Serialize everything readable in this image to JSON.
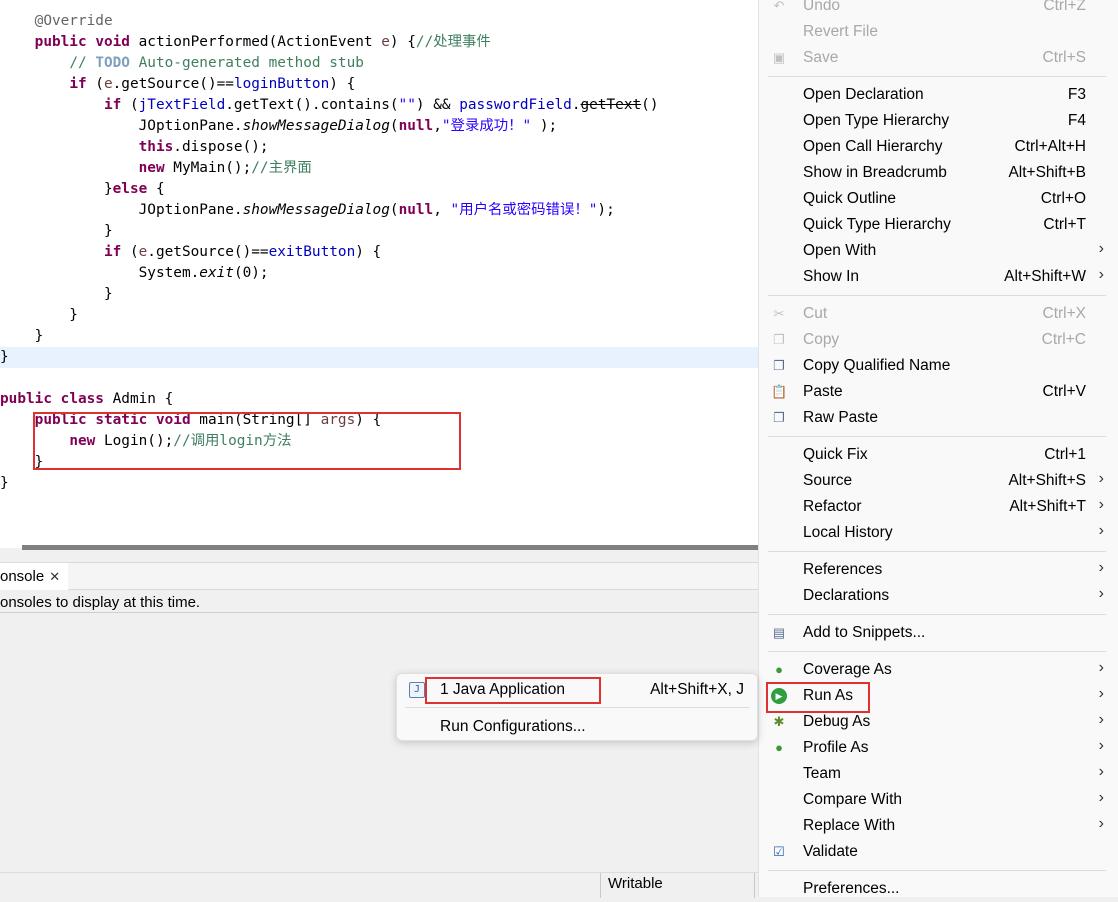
{
  "editor": {
    "lines": [
      [
        {
          "t": "    ",
          "c": ""
        },
        {
          "t": "@Override",
          "c": "ann"
        }
      ],
      [
        {
          "t": "    ",
          "c": ""
        },
        {
          "t": "public",
          "c": "kw"
        },
        {
          "t": " ",
          "c": ""
        },
        {
          "t": "void",
          "c": "kw"
        },
        {
          "t": " actionPerformed(ActionEvent ",
          "c": ""
        },
        {
          "t": "e",
          "c": "prm"
        },
        {
          "t": ") {",
          "c": ""
        },
        {
          "t": "//处理事件",
          "c": "cmt"
        }
      ],
      [
        {
          "t": "        ",
          "c": ""
        },
        {
          "t": "// ",
          "c": "cmt"
        },
        {
          "t": "TODO",
          "c": "todo"
        },
        {
          "t": " Auto-generated method stub",
          "c": "cmt"
        }
      ],
      [
        {
          "t": "        ",
          "c": ""
        },
        {
          "t": "if",
          "c": "kw"
        },
        {
          "t": " (",
          "c": ""
        },
        {
          "t": "e",
          "c": "prm"
        },
        {
          "t": ".getSource()==",
          "c": ""
        },
        {
          "t": "loginButton",
          "c": "fld"
        },
        {
          "t": ") {",
          "c": ""
        }
      ],
      [
        {
          "t": "            ",
          "c": ""
        },
        {
          "t": "if",
          "c": "kw"
        },
        {
          "t": " (",
          "c": ""
        },
        {
          "t": "jTextField",
          "c": "fld"
        },
        {
          "t": ".getText().contains(",
          "c": ""
        },
        {
          "t": "\"\"",
          "c": "str"
        },
        {
          "t": ") && ",
          "c": ""
        },
        {
          "t": "passwordField",
          "c": "fld"
        },
        {
          "t": ".",
          "c": ""
        },
        {
          "t": "getText",
          "c": "strike"
        },
        {
          "t": "()",
          "c": ""
        }
      ],
      [
        {
          "t": "                JOptionPane.",
          "c": ""
        },
        {
          "t": "showMessageDialog",
          "c": "it"
        },
        {
          "t": "(",
          "c": ""
        },
        {
          "t": "null",
          "c": "kw"
        },
        {
          "t": ",",
          "c": ""
        },
        {
          "t": "\"登录成功！\"",
          "c": "str"
        },
        {
          "t": " );",
          "c": ""
        }
      ],
      [
        {
          "t": "                ",
          "c": ""
        },
        {
          "t": "this",
          "c": "kw"
        },
        {
          "t": ".dispose();",
          "c": ""
        }
      ],
      [
        {
          "t": "                ",
          "c": ""
        },
        {
          "t": "new",
          "c": "kw"
        },
        {
          "t": " MyMain();",
          "c": ""
        },
        {
          "t": "//主界面",
          "c": "cmt"
        }
      ],
      [
        {
          "t": "            }",
          "c": ""
        },
        {
          "t": "else",
          "c": "kw"
        },
        {
          "t": " {",
          "c": ""
        }
      ],
      [
        {
          "t": "                JOptionPane.",
          "c": ""
        },
        {
          "t": "showMessageDialog",
          "c": "it"
        },
        {
          "t": "(",
          "c": ""
        },
        {
          "t": "null",
          "c": "kw"
        },
        {
          "t": ", ",
          "c": ""
        },
        {
          "t": "\"用户名或密码错误！\"",
          "c": "str"
        },
        {
          "t": ");",
          "c": ""
        }
      ],
      [
        {
          "t": "            }",
          "c": ""
        }
      ],
      [
        {
          "t": "            ",
          "c": ""
        },
        {
          "t": "if",
          "c": "kw"
        },
        {
          "t": " (",
          "c": ""
        },
        {
          "t": "e",
          "c": "prm"
        },
        {
          "t": ".getSource()==",
          "c": ""
        },
        {
          "t": "exitButton",
          "c": "fld"
        },
        {
          "t": ") {",
          "c": ""
        }
      ],
      [
        {
          "t": "                System.",
          "c": ""
        },
        {
          "t": "exit",
          "c": "it"
        },
        {
          "t": "(0);",
          "c": ""
        }
      ],
      [
        {
          "t": "            }",
          "c": ""
        }
      ],
      [
        {
          "t": "        }",
          "c": ""
        }
      ],
      [
        {
          "t": "    }",
          "c": ""
        }
      ],
      [
        {
          "t": "}",
          "c": ""
        }
      ],
      [
        {
          "t": "",
          "c": ""
        }
      ],
      [
        {
          "t": "public",
          "c": "kw"
        },
        {
          "t": " ",
          "c": ""
        },
        {
          "t": "class",
          "c": "kw"
        },
        {
          "t": " Admin {",
          "c": ""
        }
      ],
      [
        {
          "t": "    ",
          "c": ""
        },
        {
          "t": "public",
          "c": "kw"
        },
        {
          "t": " ",
          "c": ""
        },
        {
          "t": "static",
          "c": "kw"
        },
        {
          "t": " ",
          "c": ""
        },
        {
          "t": "void",
          "c": "kw"
        },
        {
          "t": " main(String[] ",
          "c": ""
        },
        {
          "t": "args",
          "c": "prm"
        },
        {
          "t": ") {",
          "c": ""
        }
      ],
      [
        {
          "t": "        ",
          "c": ""
        },
        {
          "t": "new",
          "c": "kw"
        },
        {
          "t": " Login();",
          "c": ""
        },
        {
          "t": "//调用login方法",
          "c": "cmt"
        }
      ],
      [
        {
          "t": "    }",
          "c": ""
        }
      ],
      [
        {
          "t": "}",
          "c": ""
        }
      ]
    ]
  },
  "console": {
    "tab_label": "onsole",
    "close_glyph": "✕",
    "message": "onsoles to display at this time."
  },
  "status": {
    "writable": "Writable"
  },
  "context_menu": {
    "items": [
      {
        "label": "Undo",
        "shortcut": "Ctrl+Z",
        "disabled": true,
        "icon": "undo-icon",
        "glyph": "↶"
      },
      {
        "label": "Revert File",
        "disabled": true
      },
      {
        "label": "Save",
        "shortcut": "Ctrl+S",
        "disabled": true,
        "icon": "save-icon",
        "glyph": "▣"
      },
      {
        "sep": true
      },
      {
        "label": "Open Declaration",
        "shortcut": "F3"
      },
      {
        "label": "Open Type Hierarchy",
        "shortcut": "F4"
      },
      {
        "label": "Open Call Hierarchy",
        "shortcut": "Ctrl+Alt+H"
      },
      {
        "label": "Show in Breadcrumb",
        "shortcut": "Alt+Shift+B"
      },
      {
        "label": "Quick Outline",
        "shortcut": "Ctrl+O"
      },
      {
        "label": "Quick Type Hierarchy",
        "shortcut": "Ctrl+T"
      },
      {
        "label": "Open With",
        "submenu": true
      },
      {
        "label": "Show In",
        "shortcut": "Alt+Shift+W",
        "submenu": true
      },
      {
        "sep": true
      },
      {
        "label": "Cut",
        "shortcut": "Ctrl+X",
        "disabled": true,
        "icon": "cut-icon",
        "glyph": "✂"
      },
      {
        "label": "Copy",
        "shortcut": "Ctrl+C",
        "disabled": true,
        "icon": "copy-icon",
        "glyph": "❐"
      },
      {
        "label": "Copy Qualified Name",
        "icon": "copy-qualified-name-icon",
        "glyph": "❐"
      },
      {
        "label": "Paste",
        "shortcut": "Ctrl+V",
        "icon": "paste-icon",
        "glyph": "📋"
      },
      {
        "label": "Raw Paste",
        "icon": "raw-paste-icon",
        "glyph": "❐"
      },
      {
        "sep": true
      },
      {
        "label": "Quick Fix",
        "shortcut": "Ctrl+1"
      },
      {
        "label": "Source",
        "shortcut": "Alt+Shift+S",
        "submenu": true
      },
      {
        "label": "Refactor",
        "shortcut": "Alt+Shift+T",
        "submenu": true
      },
      {
        "label": "Local History",
        "submenu": true
      },
      {
        "sep": true
      },
      {
        "label": "References",
        "submenu": true
      },
      {
        "label": "Declarations",
        "submenu": true
      },
      {
        "sep": true
      },
      {
        "label": "Add to Snippets...",
        "icon": "snippet-icon",
        "glyph": "▤"
      },
      {
        "sep": true
      },
      {
        "label": "Coverage As",
        "submenu": true,
        "icon": "coverage-icon",
        "glyph": "●"
      },
      {
        "label": "Run As",
        "submenu": true,
        "icon": "run-icon",
        "glyph": "▶",
        "highlight": true
      },
      {
        "label": "Debug As",
        "submenu": true,
        "icon": "debug-icon",
        "glyph": "✱"
      },
      {
        "label": "Profile As",
        "submenu": true,
        "icon": "profile-icon",
        "glyph": "●"
      },
      {
        "label": "Team",
        "submenu": true
      },
      {
        "label": "Compare With",
        "submenu": true
      },
      {
        "label": "Replace With",
        "submenu": true
      },
      {
        "label": "Validate",
        "icon": "validate-check-icon",
        "glyph": "☑"
      },
      {
        "sep": true
      },
      {
        "label": "Preferences..."
      }
    ],
    "arrow_glyph": "›"
  },
  "run_as_submenu": {
    "items": [
      {
        "label": "1 Java Application",
        "shortcut": "Alt+Shift+X, J",
        "icon": "java-application-icon",
        "glyph": "J"
      },
      {
        "label": "Run Configurations..."
      }
    ]
  },
  "colors": {
    "highlight_box": "#e03131",
    "run_icon_green": "#2e9e3e",
    "coverage_icon": "#3a9a3a",
    "debug_icon": "#5a8f2a"
  }
}
